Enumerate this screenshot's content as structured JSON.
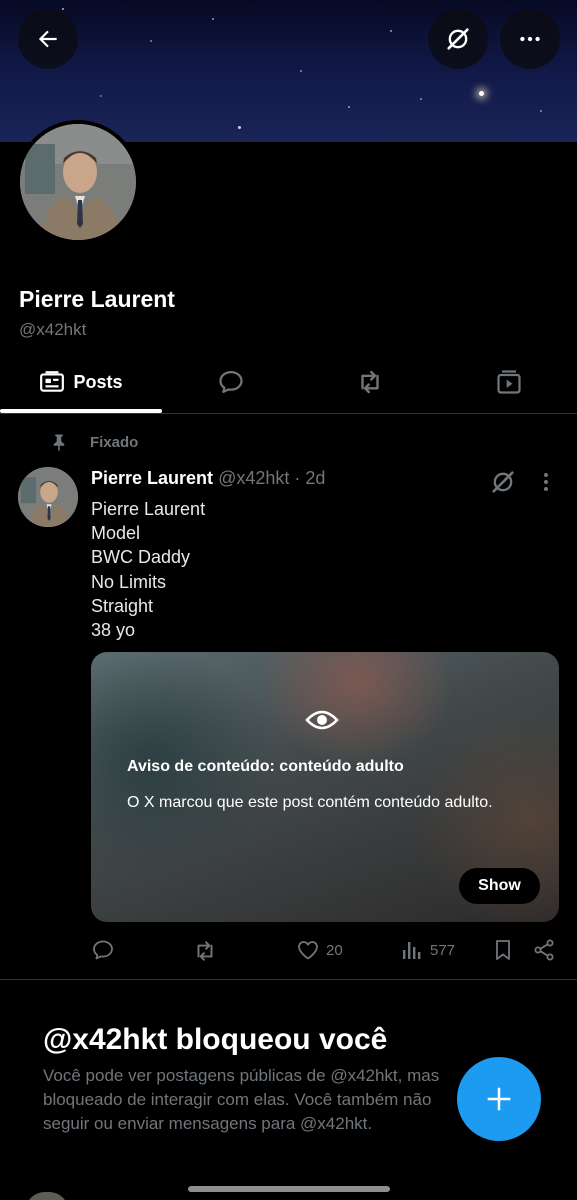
{
  "profile": {
    "name": "Pierre Laurent",
    "handle": "@x42hkt"
  },
  "header": {
    "back_icon": "arrow-left-icon",
    "grok_icon": "grok-slash-icon",
    "more_icon": "more-horizontal-icon"
  },
  "tabs": [
    {
      "label": "Posts",
      "icon": "posts-icon",
      "active": true
    },
    {
      "label": "",
      "icon": "replies-icon",
      "active": false
    },
    {
      "label": "",
      "icon": "repost-icon",
      "active": false
    },
    {
      "label": "",
      "icon": "media-icon",
      "active": false
    }
  ],
  "pinned_label": "Fixado",
  "post": {
    "author_name": "Pierre Laurent",
    "author_meta": "@x42hkt · 2d",
    "lines": [
      "Pierre Laurent",
      "Model",
      "BWC Daddy",
      "No Limits",
      "Straight",
      "38 yo"
    ],
    "warning_title": "Aviso de conteúdo: conteúdo adulto",
    "warning_desc": "O X marcou que este post contém conteúdo adulto.",
    "show_label": "Show",
    "likes": "20",
    "views": "577"
  },
  "blocked": {
    "title": "@x42hkt bloqueou você",
    "line1": "Você pode ver postagens públicas de @x42hkt, mas",
    "line2": "bloqueado de interagir com elas. Você também não",
    "line3": "seguir ou enviar mensagens para @x42hkt."
  },
  "colors": {
    "accent": "#1d9bf0",
    "muted": "#71767b",
    "background": "#000000"
  }
}
